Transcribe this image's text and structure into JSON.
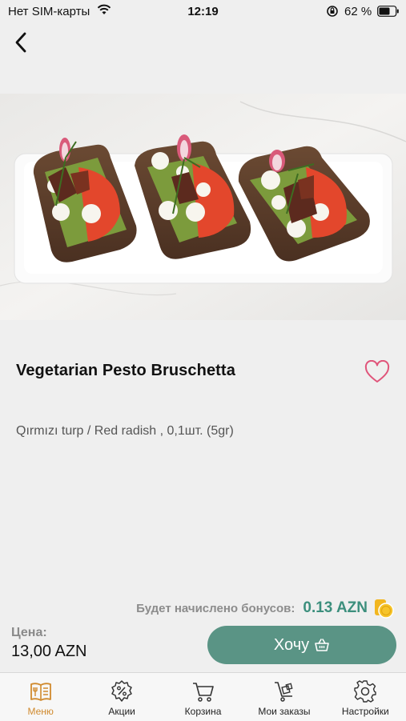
{
  "status_bar": {
    "carrier": "Нет SIM-карты",
    "time": "12:19",
    "battery": "62 %"
  },
  "product": {
    "title": "Vegetarian Pesto Bruschetta",
    "description": "Qırmızı turp / Red radish , 0,1шт. (5gr)",
    "image": "bruschetta-photo"
  },
  "bonus": {
    "label": "Будет начислено бонусов:",
    "value": "0.13 AZN"
  },
  "price": {
    "label": "Цена:",
    "value": "13,00 AZN"
  },
  "action": {
    "want_label": "Хочу"
  },
  "tabs": [
    {
      "label": "Меню",
      "icon": "menu-book-icon",
      "active": true
    },
    {
      "label": "Акции",
      "icon": "discount-icon",
      "active": false
    },
    {
      "label": "Корзина",
      "icon": "cart-icon",
      "active": false
    },
    {
      "label": "Мои заказы",
      "icon": "orders-trolley-icon",
      "active": false
    },
    {
      "label": "Настройки",
      "icon": "gear-icon",
      "active": false
    }
  ],
  "colors": {
    "accent": "#5a9485",
    "bonus_value": "#3c8f7d",
    "active_tab": "#d08a2e",
    "favorite": "#e0547a"
  }
}
